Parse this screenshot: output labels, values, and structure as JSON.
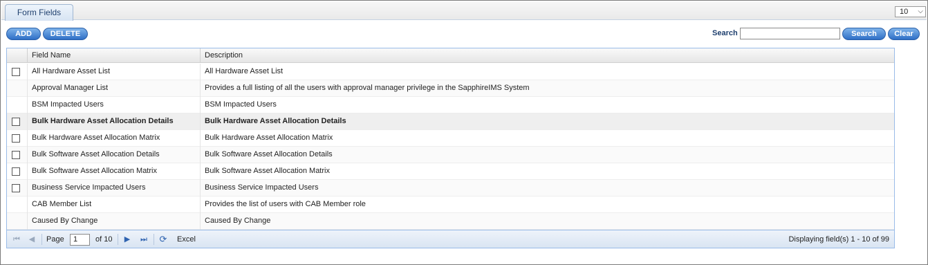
{
  "tab": {
    "title": "Form Fields"
  },
  "page_size": {
    "value": "10"
  },
  "toolbar": {
    "add_label": "ADD",
    "delete_label": "DELETE"
  },
  "search": {
    "label": "Search",
    "value": "",
    "search_label": "Search",
    "clear_label": "Clear"
  },
  "grid": {
    "columns": [
      "Field Name",
      "Description"
    ],
    "rows": [
      {
        "name": "All Hardware Asset List",
        "description": "All Hardware Asset List",
        "checkbox": true
      },
      {
        "name": "Approval Manager List",
        "description": "Provides a full listing of all the users with approval manager privilege in the SapphireIMS System",
        "checkbox": false
      },
      {
        "name": "BSM Impacted Users",
        "description": "BSM Impacted Users",
        "checkbox": false
      },
      {
        "name": "Bulk Hardware Asset Allocation Details",
        "description": "Bulk Hardware Asset Allocation Details",
        "checkbox": true,
        "selected": true
      },
      {
        "name": "Bulk Hardware Asset Allocation Matrix",
        "description": "Bulk Hardware Asset Allocation Matrix",
        "checkbox": true
      },
      {
        "name": "Bulk Software Asset Allocation Details",
        "description": "Bulk Software Asset Allocation Details",
        "checkbox": true
      },
      {
        "name": "Bulk Software Asset Allocation Matrix",
        "description": "Bulk Software Asset Allocation Matrix",
        "checkbox": true
      },
      {
        "name": "Business Service Impacted Users",
        "description": "Business Service Impacted Users",
        "checkbox": true
      },
      {
        "name": "CAB Member List",
        "description": "Provides the list of users with CAB Member role",
        "checkbox": false
      },
      {
        "name": "Caused By Change",
        "description": "Caused By Change",
        "checkbox": false
      }
    ]
  },
  "pager": {
    "page_label": "Page",
    "page_value": "1",
    "of_label": "of 10",
    "excel_label": "Excel",
    "display_text": "Displaying field(s) 1 - 10 of 99"
  },
  "colors": {
    "accent": "#2f6fc6",
    "header_text": "#1e3f6e",
    "grid_border": "#99bbe8"
  },
  "icons": [
    "first-page-icon",
    "prev-page-icon",
    "next-page-icon",
    "last-page-icon",
    "refresh-icon",
    "chevron-down-icon"
  ]
}
